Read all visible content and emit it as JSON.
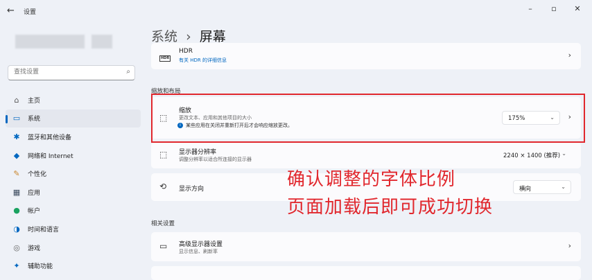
{
  "window": {
    "title": "设置",
    "back_icon": "←",
    "min_icon": "–",
    "max_icon": "▫",
    "close_icon": "✕"
  },
  "search": {
    "placeholder": "查找设置"
  },
  "sidebar": {
    "items": [
      {
        "label": "主页",
        "icon": "⌂"
      },
      {
        "label": "系统",
        "icon": "▭"
      },
      {
        "label": "蓝牙和其他设备",
        "icon": "✱"
      },
      {
        "label": "网络和 Internet",
        "icon": "◆"
      },
      {
        "label": "个性化",
        "icon": "✎"
      },
      {
        "label": "应用",
        "icon": "▦"
      },
      {
        "label": "帐户",
        "icon": "●"
      },
      {
        "label": "时间和语言",
        "icon": "◑"
      },
      {
        "label": "游戏",
        "icon": "◎"
      },
      {
        "label": "辅助功能",
        "icon": "✦"
      }
    ]
  },
  "breadcrumb": {
    "parent": "系统",
    "separator": "›",
    "current": "屏幕"
  },
  "hdr": {
    "title": "HDR",
    "link": "有关 HDR 的详细信息",
    "icon_text": "HDR"
  },
  "section_scale_layout": "缩放和布局",
  "scale": {
    "title": "缩放",
    "subtitle": "更改文本、应用和其他项目的大小",
    "notice": "某些应用在关闭并重新打开后才会响应缩放更改。",
    "value": "175%"
  },
  "resolution": {
    "title": "显示器分辨率",
    "subtitle": "调整分辨率以适合所连接的显示器",
    "value": "2240 × 1400 (推荐)"
  },
  "orientation": {
    "title": "显示方向",
    "value": "横向"
  },
  "section_related": "相关设置",
  "advanced": {
    "title": "高级显示器设置",
    "subtitle": "显示信息、刷新率"
  },
  "overlay": {
    "line1": "确认调整的字体比例",
    "line2": "页面加载后即可成功切换"
  },
  "colors": {
    "accent": "#0067c0",
    "highlight": "#e1272d"
  }
}
